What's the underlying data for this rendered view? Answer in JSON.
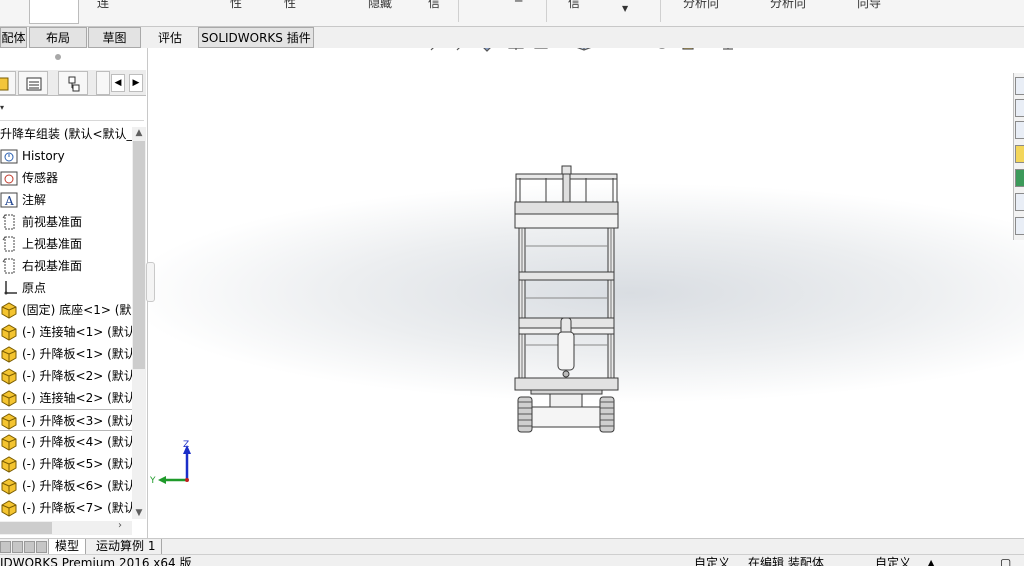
{
  "ribbon": {
    "fragments": [
      "连",
      "性",
      "性",
      "隐藏",
      "信",
      "分析向",
      "分析向",
      "向导"
    ]
  },
  "command_tabs": [
    "配体",
    "布局",
    "草图",
    "评估",
    "SOLIDWORKS 插件"
  ],
  "feature_tree": {
    "root_label": "升降车组装 (默认<默认_",
    "items": [
      {
        "label": "History",
        "icon": "history-icon"
      },
      {
        "label": "传感器",
        "icon": "sensor-icon"
      },
      {
        "label": "注解",
        "icon": "annotation-icon"
      },
      {
        "label": "前视基准面",
        "icon": "plane-icon"
      },
      {
        "label": "上视基准面",
        "icon": "plane-icon"
      },
      {
        "label": "右视基准面",
        "icon": "plane-icon"
      },
      {
        "label": "原点",
        "icon": "origin-icon"
      },
      {
        "label": "(固定) 底座<1> (默认",
        "icon": "part-icon"
      },
      {
        "label": "(-) 连接轴<1> (默认",
        "icon": "part-icon"
      },
      {
        "label": "(-) 升降板<1> (默认",
        "icon": "part-icon"
      },
      {
        "label": "(-) 升降板<2> (默认",
        "icon": "part-icon"
      },
      {
        "label": "(-) 连接轴<2> (默认",
        "icon": "part-icon"
      },
      {
        "label": "(-) 升降板<3> (默认",
        "icon": "part-icon"
      },
      {
        "label": "(-) 升降板<4> (默认",
        "icon": "part-icon"
      },
      {
        "label": "(-) 升降板<5> (默认",
        "icon": "part-icon"
      },
      {
        "label": "(-) 升降板<6> (默认",
        "icon": "part-icon"
      },
      {
        "label": "(-) 升降板<7> (默认",
        "icon": "part-icon"
      }
    ]
  },
  "triad": {
    "z": "Z",
    "y": "Y"
  },
  "bottom_tabs": [
    "模型",
    "运动算例 1"
  ],
  "status": {
    "product": "IDWORKS Premium 2016 x64 版",
    "custom1": "自定义",
    "editing": "在编辑 装配体",
    "custom2": "自定义"
  },
  "colors": {
    "viewport_center": "#d9dde2",
    "axis_z": "#1a2ec8",
    "axis_y": "#1f9a2a",
    "part_icon": "#f0c020"
  }
}
